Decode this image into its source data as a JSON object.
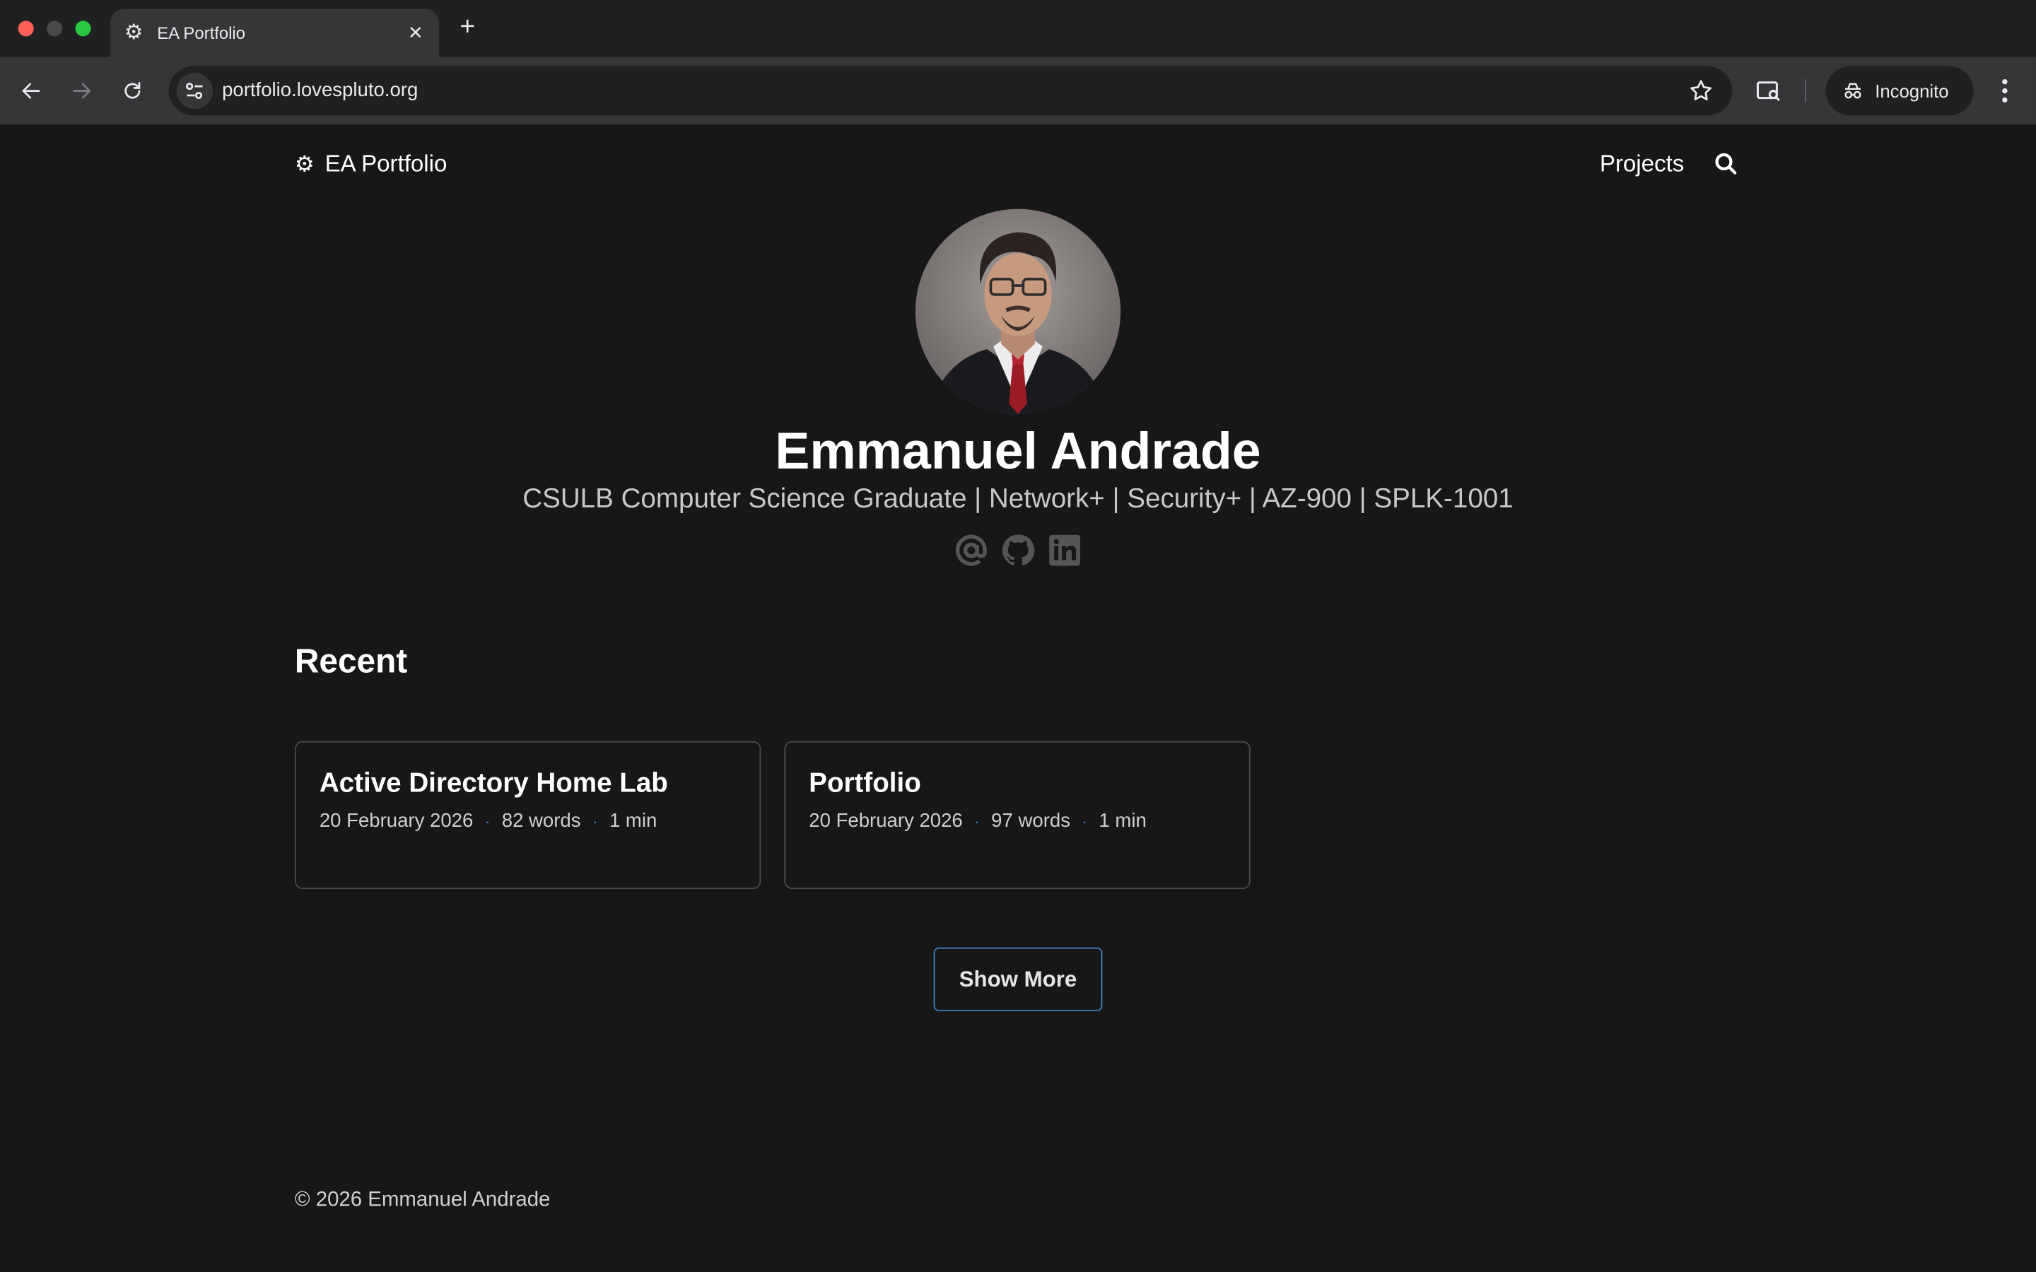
{
  "browser": {
    "tab_title": "EA Portfolio",
    "tab_favicon": "⚙",
    "tab_close": "✕",
    "new_tab": "+",
    "url": "portfolio.lovespluto.org",
    "incognito_label": "Incognito"
  },
  "site": {
    "logo_icon": "⚙",
    "logo_text": "EA Portfolio",
    "nav": {
      "projects": "Projects"
    }
  },
  "hero": {
    "name": "Emmanuel Andrade",
    "subtitle": "CSULB Computer Science Graduate | Network+ | Security+ | AZ-900 | SPLK-1001",
    "socials": [
      "email-icon",
      "github-icon",
      "linkedin-icon"
    ]
  },
  "recent": {
    "title": "Recent",
    "cards": [
      {
        "title": "Active Directory Home Lab",
        "date": "20 February 2026",
        "words": "82 words",
        "read_time": "1 min"
      },
      {
        "title": "Portfolio",
        "date": "20 February 2026",
        "words": "97 words",
        "read_time": "1 min"
      }
    ],
    "separator": "·",
    "show_more": "Show More"
  },
  "footer": {
    "copyright": "© 2026 Emmanuel Andrade"
  },
  "colors": {
    "background": "#171717",
    "accent": "#3d7fc4",
    "card_border": "#4a4a4a"
  }
}
